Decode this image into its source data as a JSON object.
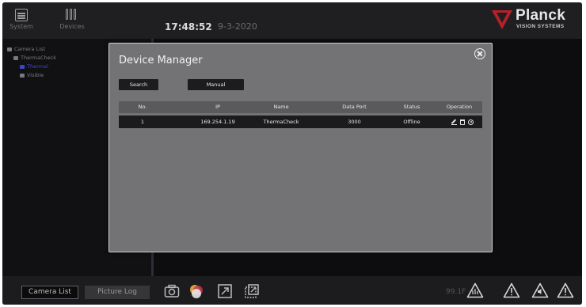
{
  "topbar": {
    "system_label": "System",
    "devices_label": "Devices",
    "clock": "17:48:52",
    "date": "9-3-2020",
    "brand_name": "Planck",
    "brand_sub": "VISION SYSTEMS",
    "brand_color": "#b6202a"
  },
  "sidebar": {
    "root": "Camera List",
    "device": "ThermaCheck",
    "children": [
      {
        "label": "Thermal",
        "selected": true
      },
      {
        "label": "Visible",
        "selected": false
      }
    ]
  },
  "modal": {
    "title": "Device Manager",
    "search_label": "Search",
    "manual_label": "Manual",
    "columns": [
      "No.",
      "IP",
      "Name",
      "Data Port",
      "Status",
      "Operation"
    ],
    "rows": [
      {
        "no": "1",
        "ip": "169.254.1.19",
        "name": "ThermaCheck",
        "port": "3000",
        "status": "Offline",
        "ops": [
          "edit-icon",
          "delete-icon",
          "settings-icon"
        ]
      }
    ]
  },
  "bottombar": {
    "tab_camera_list": "Camera List",
    "tab_picture_log": "Picture Log",
    "temperature": "99.1F",
    "icons": [
      "camera-icon",
      "color-palette-icon",
      "expand-icon",
      "popout-icon"
    ],
    "warnings": [
      "temperature-warning-icon",
      "warning-icon",
      "audio-warning-icon",
      "warning-icon"
    ]
  }
}
